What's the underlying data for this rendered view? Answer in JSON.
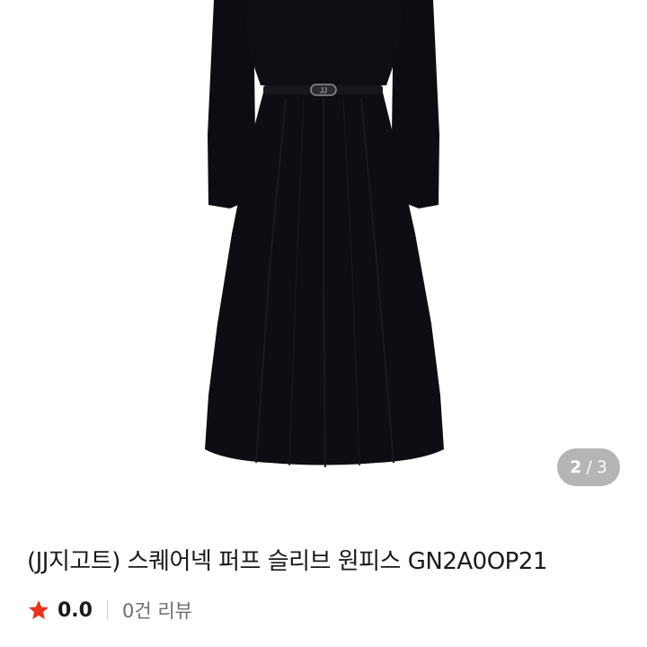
{
  "product_image": {
    "description_icon": "black-dress-photo",
    "belt_logo": "JJ"
  },
  "pager": {
    "current": "2",
    "separator": "/",
    "total": "3"
  },
  "product": {
    "title": "(JJ지고트) 스퀘어넥 퍼프 슬리브 원피스 GN2A0OP21"
  },
  "rating": {
    "icon": "star-icon",
    "star_color": "#e8341c",
    "score": "0.0",
    "review_text": "0건 리뷰"
  }
}
